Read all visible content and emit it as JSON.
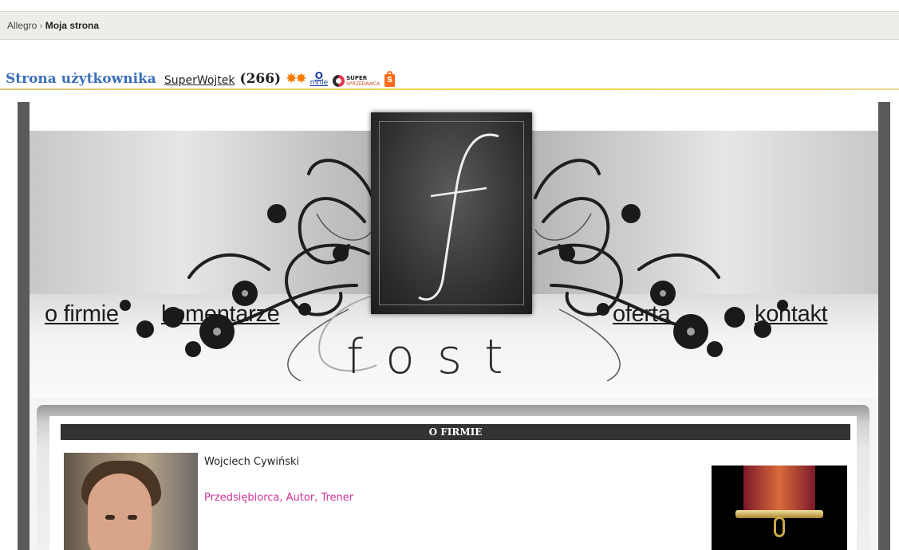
{
  "breadcrumb": {
    "root": "Allegro",
    "separator": "›",
    "current": "Moja strona"
  },
  "user_header": {
    "prefix": "Strona użytkownika",
    "username": "SuperWojtek",
    "score": "(266)",
    "stars_icon": "stars-icon",
    "o_mnie_top": "O",
    "o_mnie_bottom": "mnie",
    "super_top": "SUPER",
    "super_bottom": "SPRZEDAWCA",
    "shop_icon": "shop-bag-icon",
    "shop_letter": "S",
    "accent_color": "#3d6fb8"
  },
  "shop": {
    "nav": {
      "about": "o firmie",
      "comments": "komentarze",
      "offer": "oferta",
      "contact": "kontakt"
    },
    "logo_letter": "f",
    "logo_word": "fost",
    "section_title": "O FIRMIE",
    "person_name": "Wojciech Cywiński",
    "person_roles": "Przedsiębiorca, Autor, Trener",
    "role_color": "#cc3399"
  }
}
